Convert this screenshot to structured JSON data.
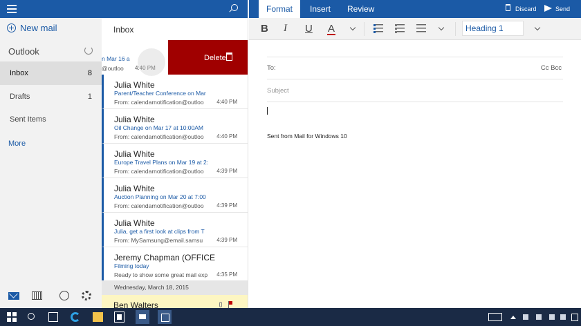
{
  "nav": {
    "new_mail": "New mail",
    "account": "Outlook",
    "folders": [
      {
        "label": "Inbox",
        "count": "8"
      },
      {
        "label": "Drafts",
        "count": "1"
      },
      {
        "label": "Sent Items",
        "count": ""
      }
    ],
    "more": "More"
  },
  "list": {
    "title": "Inbox",
    "swiped": {
      "subject": "n Mar 16 a",
      "preview": "@outloo",
      "time": "4:40 PM",
      "action": "Delete"
    },
    "messages": [
      {
        "sender": "Julia White",
        "subject": "Parent/Teacher Conference on Mar",
        "preview": "From: calendarnotification@outloo",
        "time": "4:40 PM"
      },
      {
        "sender": "Julia White",
        "subject": "Oil Change on Mar 17 at 10:00AM",
        "preview": "From: calendarnotification@outloo",
        "time": "4:40 PM"
      },
      {
        "sender": "Julia White",
        "subject": "Europe Travel Plans on Mar 19 at 2:",
        "preview": "From: calendarnotification@outloo",
        "time": "4:39 PM"
      },
      {
        "sender": "Julia White",
        "subject": "Auction Planning on Mar 20 at 7:00",
        "preview": "From: calendarnotification@outloo",
        "time": "4:39 PM"
      },
      {
        "sender": "Julia White",
        "subject": "Julia, get a first look at clips from T",
        "preview": "From: MySamsung@email.samsu",
        "time": "4:39 PM"
      },
      {
        "sender": "Jeremy Chapman (OFFICE",
        "subject": "Filming today",
        "preview": "Ready to show some great mail exp",
        "time": "4:35 PM"
      }
    ],
    "date_header": "Wednesday, March 18, 2015",
    "flagged_sender": "Ben Walters"
  },
  "compose": {
    "tabs": [
      "Format",
      "Insert",
      "Review"
    ],
    "discard": "Discard",
    "send": "Send",
    "style": "Heading 1",
    "to_label": "To:",
    "ccbcc": "Cc Bcc",
    "subject_placeholder": "Subject",
    "signature": "Sent from Mail for Windows 10"
  },
  "colors": {
    "accent": "#1b5aa6",
    "delete": "#a00000",
    "taskbar": "#1a2a45",
    "flag": "#fdf6c2"
  }
}
